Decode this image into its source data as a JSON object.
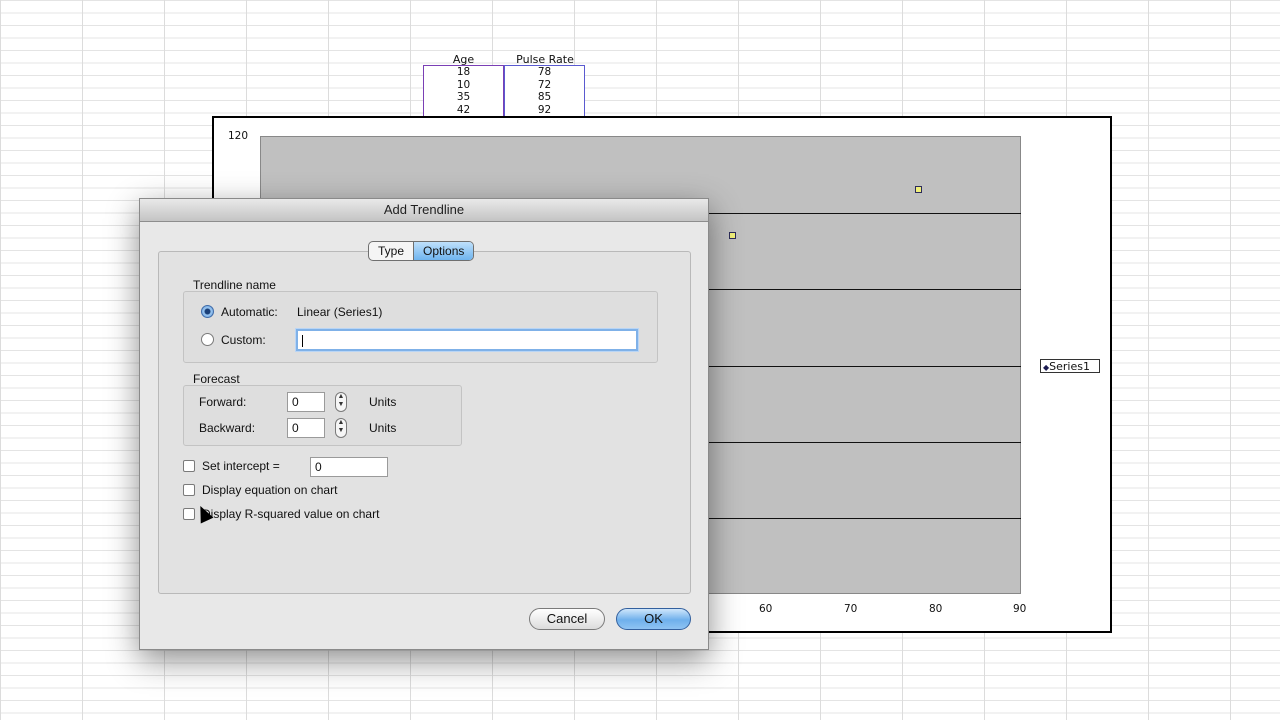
{
  "sheet": {
    "headers": [
      "Age",
      "Pulse Rate"
    ],
    "rows": [
      [
        "18",
        "78"
      ],
      [
        "10",
        "72"
      ],
      [
        "35",
        "85"
      ],
      [
        "42",
        "92"
      ]
    ]
  },
  "chart_data": {
    "type": "scatter",
    "title": "",
    "xlabel": "",
    "ylabel": "",
    "x_ticks": [
      "60",
      "70",
      "80",
      "90"
    ],
    "y_ticks": [
      "120"
    ],
    "ylim": [
      0,
      120
    ],
    "xlim": [
      0,
      90
    ],
    "series": [
      {
        "name": "Series1",
        "points": [
          {
            "x": 56,
            "y": 94
          },
          {
            "x": 78,
            "y": 106
          }
        ]
      }
    ],
    "legend": "right",
    "grid": true,
    "colors": {
      "plot_bg": "#c0c0c0",
      "marker_fill": "#f1f07a",
      "marker_edge": "#2b2b59"
    }
  },
  "dialog": {
    "title": "Add Trendline",
    "tabs": [
      {
        "label": "Type"
      },
      {
        "label": "Options"
      }
    ],
    "active_tab": "Options",
    "trendline_name": {
      "title": "Trendline name",
      "automatic_label": "Automatic:",
      "automatic_value": "Linear (Series1)",
      "custom_label": "Custom:",
      "custom_value": "",
      "selected": "automatic"
    },
    "forecast": {
      "title": "Forecast",
      "forward_label": "Forward:",
      "forward_value": "0",
      "backward_label": "Backward:",
      "backward_value": "0",
      "units_label": "Units"
    },
    "options": {
      "set_intercept_label": "Set intercept =",
      "set_intercept_value": "0",
      "display_equation_label": "Display equation on chart",
      "display_rsquared_label": "Display R-squared value on chart"
    },
    "buttons": {
      "cancel": "Cancel",
      "ok": "OK"
    }
  }
}
